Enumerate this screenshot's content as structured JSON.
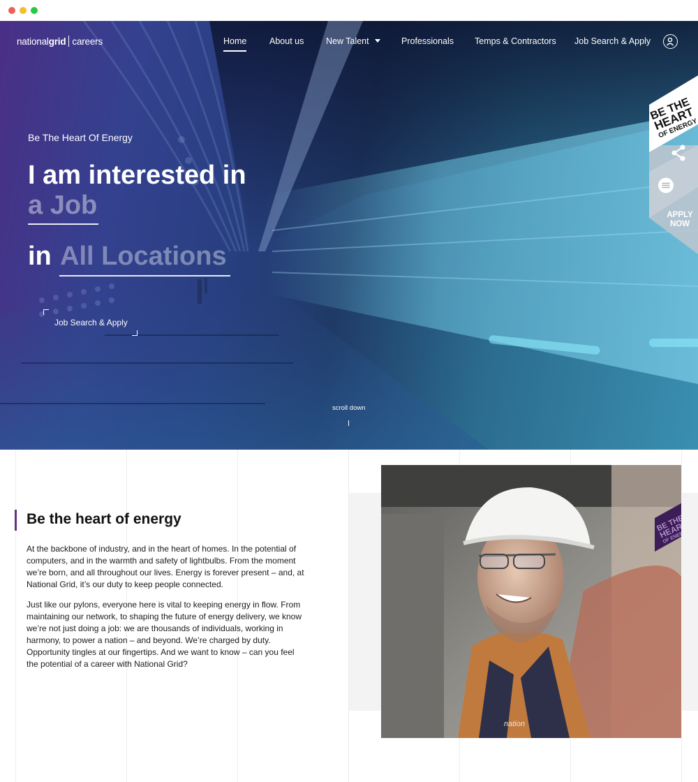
{
  "window": {
    "controls": [
      "close",
      "minimize",
      "maximize"
    ]
  },
  "nav": {
    "logo": {
      "part1": "national",
      "part2": "grid",
      "part3": "careers"
    },
    "items": [
      {
        "label": "Home",
        "active": true
      },
      {
        "label": "About us"
      },
      {
        "label": "New Talent",
        "has_dropdown": true
      },
      {
        "label": "Professionals"
      },
      {
        "label": "Temps & Contractors"
      },
      {
        "label": "Job Search & Apply"
      }
    ],
    "account_icon": "user-circle-icon"
  },
  "hero": {
    "eyebrow": "Be The Heart Of Energy",
    "headline_line1": "I am interested in",
    "job_selector": "a Job",
    "location_prefix": "in",
    "location_selector": "All Locations",
    "cta_label": "Job Search & Apply",
    "scroll_label": "scroll down"
  },
  "side_tab": {
    "badge": [
      "BE THE",
      "HEART",
      "OF ENERGY"
    ],
    "share_icon": "share-icon",
    "chat_icon": "chat-icon",
    "apply_label_1": "APPLY",
    "apply_label_2": "NOW"
  },
  "section": {
    "heading": "Be the heart of energy",
    "para1": "At the backbone of industry, and in the heart of homes. In the potential of computers, and in the warmth and safety of lightbulbs. From the moment we’re born, and all throughout our lives. Energy is forever present – and, at National Grid, it’s our duty to keep people connected.",
    "para2": "Just like our pylons, everyone here is vital to keeping energy in flow. From maintaining our network, to shaping the future of energy delivery, we know we’re not just doing a job: we are thousands of individuals, working in harmony, to power a nation – and beyond. We’re charged by duty. Opportunity tingles at our fingertips. And we want to know – can you feel the potential of a career with National Grid?",
    "photo_badge": [
      "BE THE",
      "HEART",
      "OF ENERGY"
    ],
    "vest_text": "nation"
  },
  "colors": {
    "brand_purple": "#6b2d82",
    "hero_purple": "#4a2f86",
    "hero_teal": "#3a8fb0",
    "nav_text": "#ffffff"
  }
}
